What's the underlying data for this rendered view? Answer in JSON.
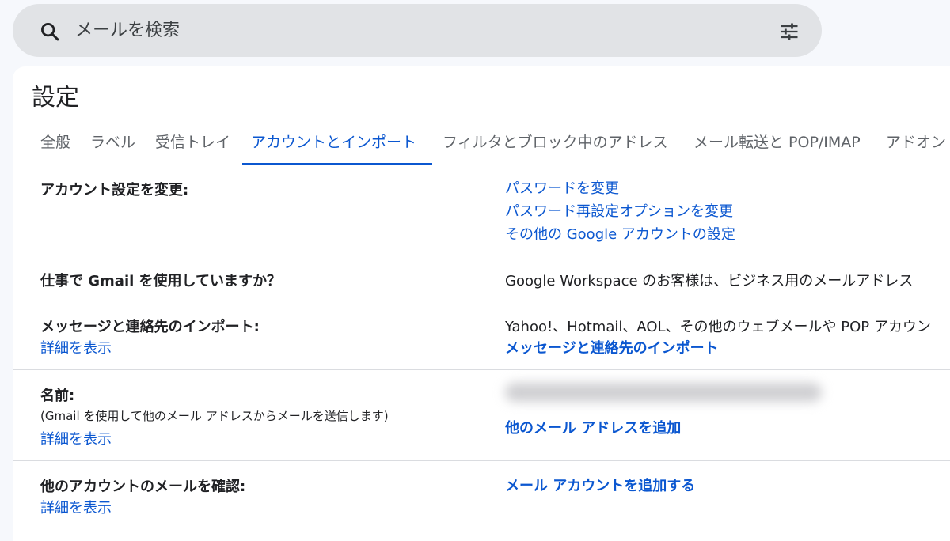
{
  "search": {
    "placeholder": "メールを検索",
    "icon": "search-icon",
    "options_icon": "tune-icon"
  },
  "page_title": "設定",
  "tabs": [
    {
      "label": "全般"
    },
    {
      "label": "ラベル"
    },
    {
      "label": "受信トレイ"
    },
    {
      "label": "アカウントとインポート",
      "active": true
    },
    {
      "label": "フィルタとブロック中のアドレス"
    },
    {
      "label": "メール転送と POP/IMAP"
    },
    {
      "label": "アドオン"
    }
  ],
  "rows": {
    "account_settings": {
      "label": "アカウント設定を変更:",
      "links": [
        "パスワードを変更",
        "パスワード再設定オプションを変更",
        "その他の Google アカウントの設定"
      ]
    },
    "work": {
      "label": "仕事で Gmail を使用していますか？",
      "value": "Google Workspace のお客様は、ビジネス用のメールアドレス"
    },
    "import": {
      "label": "メッセージと連絡先のインポート:",
      "details": "詳細を表示",
      "value": "Yahoo!、Hotmail、AOL、その他のウェブメールや POP アカウン",
      "action": "メッセージと連絡先のインポート"
    },
    "name": {
      "label": "名前:",
      "sublabel": "(Gmail を使用して他のメール アドレスからメールを送信します)",
      "details": "詳細を表示",
      "action": "他のメール アドレスを追加"
    },
    "check_mail": {
      "label": "他のアカウントのメールを確認:",
      "details": "詳細を表示",
      "action": "メール アカウントを追加する"
    }
  },
  "colors": {
    "accent": "#0b57d0",
    "text": "#202124",
    "search_bg": "#e1e3e6",
    "page_bg": "#f6f8fc"
  }
}
